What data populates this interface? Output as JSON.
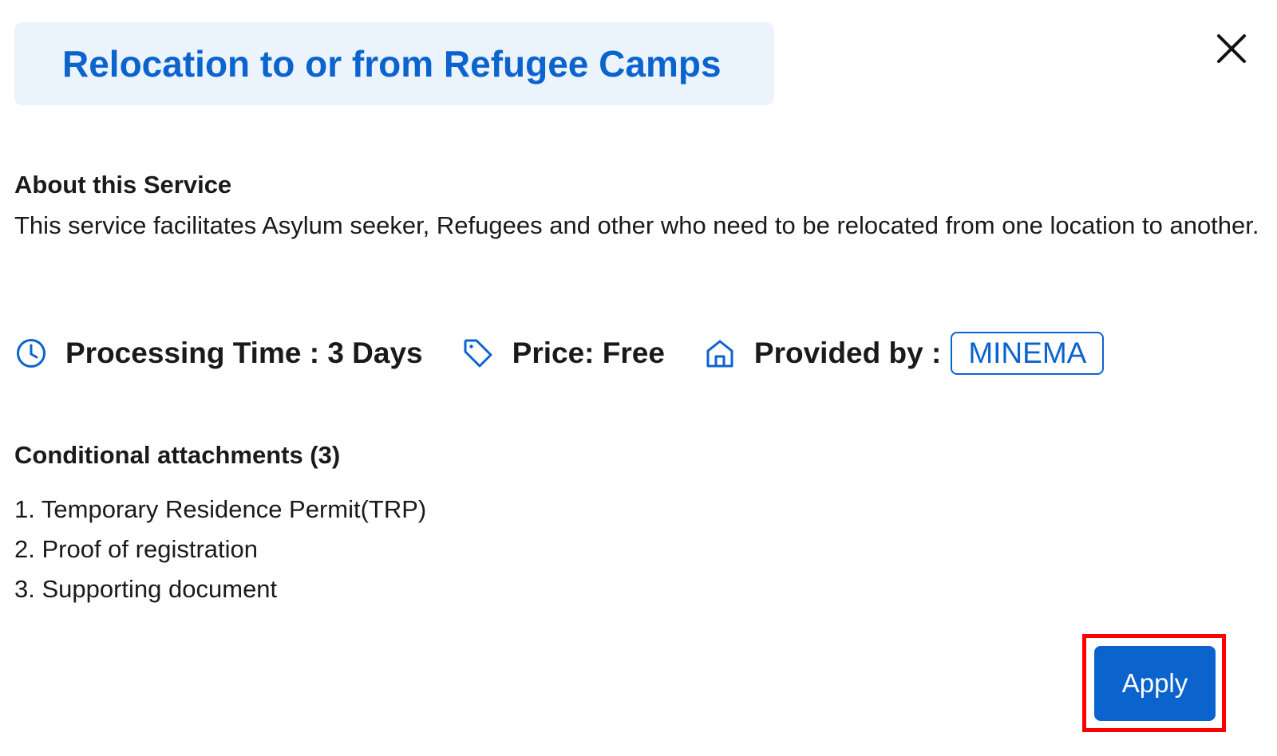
{
  "dialog": {
    "title": "Relocation to or from Refugee Camps",
    "close_icon": "close-icon"
  },
  "about": {
    "heading": "About this Service",
    "description": "This service facilitates Asylum seeker, Refugees and other who need to be relocated from one location to another."
  },
  "meta": {
    "processing_time": "Processing Time : 3 Days",
    "processing_icon": "clock-icon",
    "price": "Price: Free",
    "price_icon": "tag-icon",
    "provided_by_label": "Provided by :",
    "provider_icon": "home-icon",
    "provider": "MINEMA"
  },
  "attachments": {
    "heading": "Conditional attachments (3)",
    "items": [
      "1. Temporary Residence Permit(TRP)",
      "2. Proof of registration",
      "3. Supporting document"
    ]
  },
  "actions": {
    "apply_label": "Apply"
  },
  "colors": {
    "accent": "#0b63ce",
    "title_background": "#ebf3fd",
    "highlight": "#ff0000"
  }
}
